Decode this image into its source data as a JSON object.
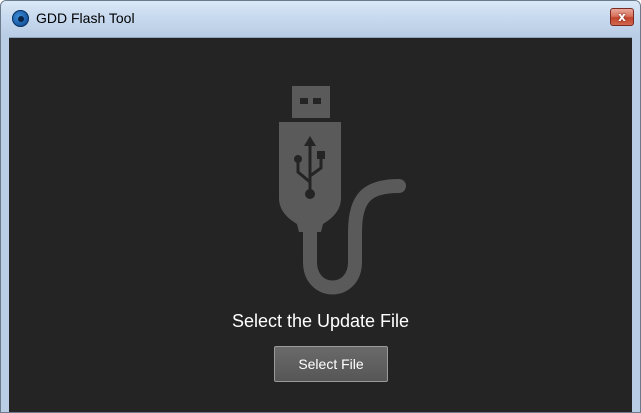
{
  "window": {
    "title": "GDD Flash Tool",
    "close_label": "x",
    "icon": "app-globe-icon"
  },
  "main": {
    "illustration": "usb-cable-icon",
    "heading": "Select the Update File",
    "select_button_label": "Select File"
  },
  "colors": {
    "client_background": "#242424",
    "illustration": "#5a5a5a",
    "button_background": "#5e5e5e",
    "text": "#ffffff"
  }
}
